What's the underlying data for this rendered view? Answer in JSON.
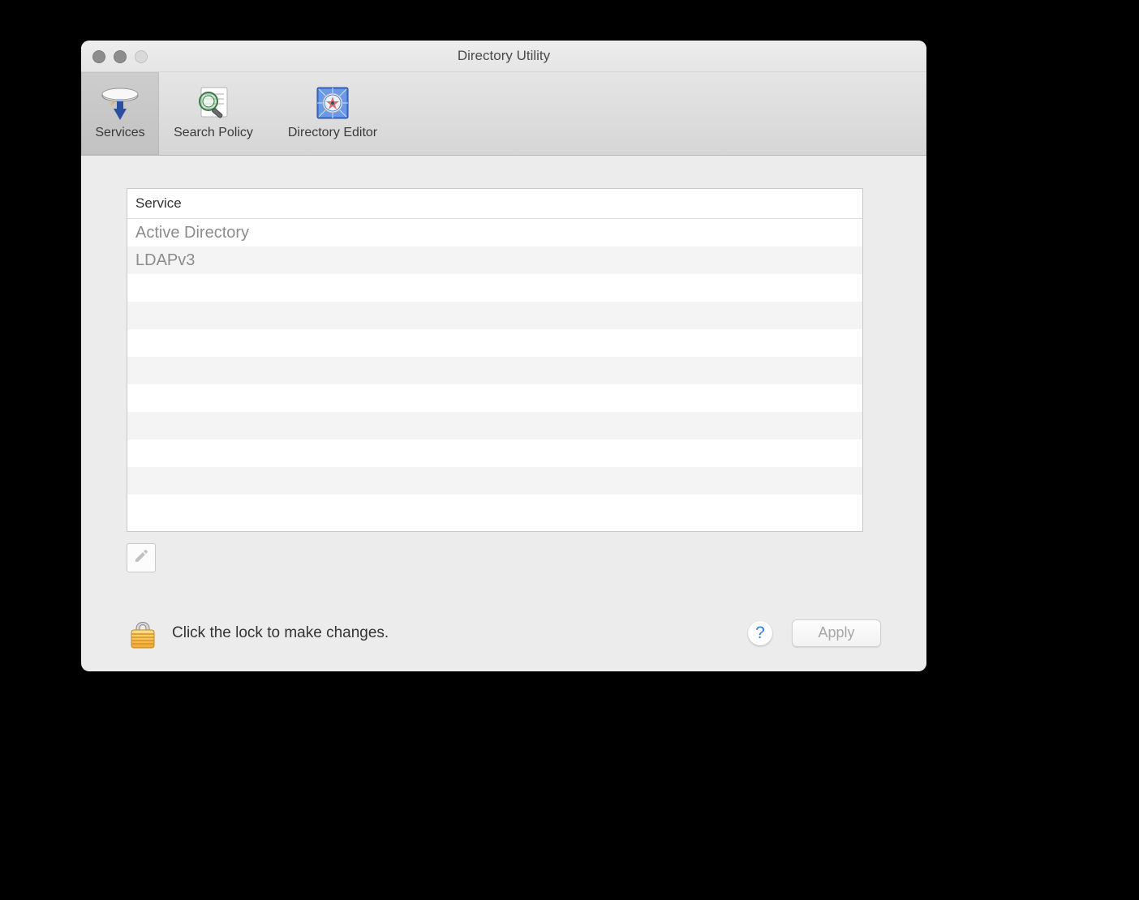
{
  "window": {
    "title": "Directory Utility"
  },
  "toolbar": {
    "services_label": "Services",
    "search_policy_label": "Search Policy",
    "directory_editor_label": "Directory Editor",
    "selected": "services"
  },
  "table": {
    "header": "Service",
    "rows": [
      "Active Directory",
      "LDAPv3"
    ],
    "visible_row_slots": 11
  },
  "footer": {
    "lock_message": "Click the lock to make changes.",
    "help_symbol": "?",
    "apply_label": "Apply",
    "apply_enabled": false
  }
}
